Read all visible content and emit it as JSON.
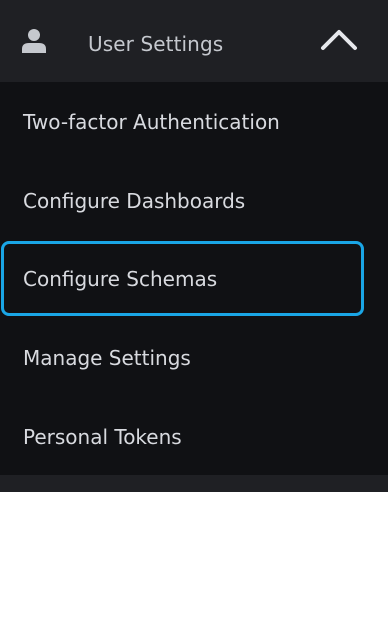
{
  "colors": {
    "panel_background": "#101114",
    "header_background": "#1f2024",
    "text": "#d8dadf",
    "focus_ring": "#1aa6e6"
  },
  "header": {
    "icon": "user-icon",
    "label": "User Settings",
    "toggle_icon": "chevron-up-icon",
    "expanded": true
  },
  "submenu": {
    "items": [
      {
        "label": "Two-factor Authentication"
      },
      {
        "label": "Configure Dashboards"
      },
      {
        "label": "Configure Schemas",
        "focused": true
      },
      {
        "label": "Manage Settings"
      },
      {
        "label": "Personal Tokens"
      }
    ]
  }
}
